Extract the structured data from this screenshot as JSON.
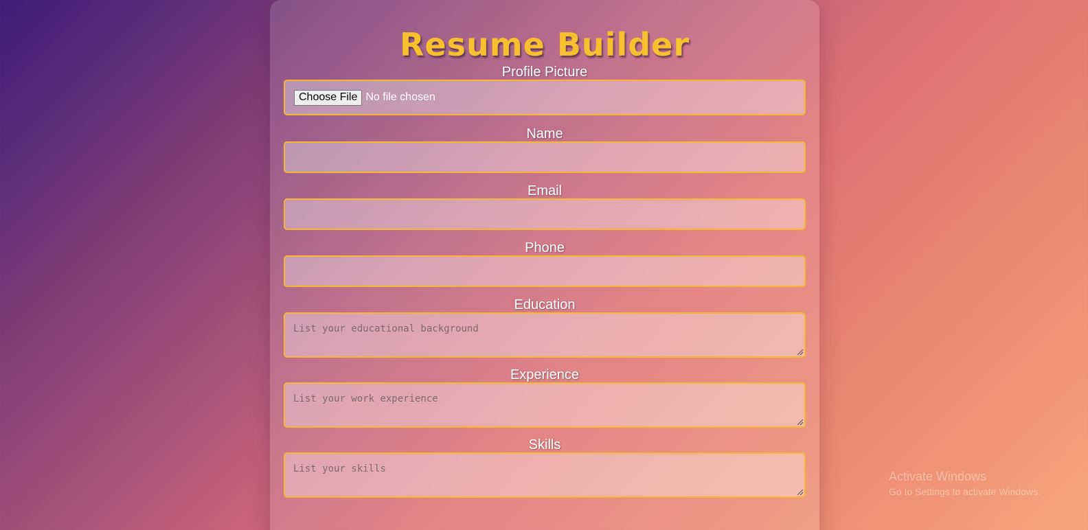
{
  "app": {
    "title": "Resume Builder"
  },
  "form": {
    "profile_picture": {
      "label": "Profile Picture",
      "button_label": "Choose File",
      "status": "No file chosen"
    },
    "name": {
      "label": "Name",
      "value": "",
      "placeholder": ""
    },
    "email": {
      "label": "Email",
      "value": "",
      "placeholder": ""
    },
    "phone": {
      "label": "Phone",
      "value": "",
      "placeholder": ""
    },
    "education": {
      "label": "Education",
      "placeholder": "List your educational background"
    },
    "experience": {
      "label": "Experience",
      "placeholder": "List your work experience"
    },
    "skills": {
      "label": "Skills",
      "placeholder": "List your skills"
    }
  },
  "watermark": {
    "title": "Activate Windows",
    "subtitle": "Go to Settings to activate Windows."
  },
  "colors": {
    "accent": "#f7c02e",
    "field_border": "#f7b733",
    "label_text": "#ffffff"
  }
}
